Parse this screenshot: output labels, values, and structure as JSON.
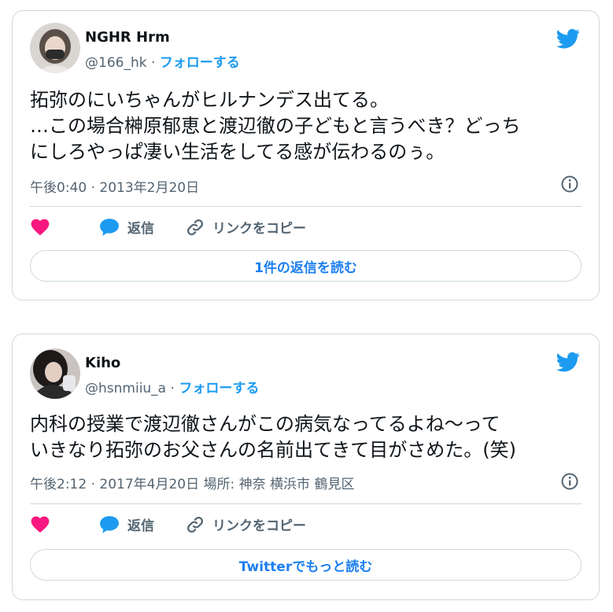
{
  "tweets": [
    {
      "display_name": "NGHR Hrm",
      "handle": "@166_hk",
      "separator": " · ",
      "follow_label": "フォローする",
      "text_lines": [
        "拓弥のにいちゃんがヒルナンデス出てる。",
        "…この場合榊原郁恵と渡辺徹の子どもと言うべき？どっち",
        "にしろやっぱ凄い生活をしてる感が伝わるのぅ。"
      ],
      "meta": "午後0:40 · 2013年2月20日",
      "reply_label": "返信",
      "copy_link_label": "リンクをコピー",
      "more_button_label": "1件の返信を読む"
    },
    {
      "display_name": "Kiho",
      "handle": "@hsnmiiu_a",
      "separator": " · ",
      "follow_label": "フォローする",
      "text_lines": [
        "内科の授業で渡辺徹さんがこの病気なってるよね〜って",
        "いきなり拓弥のお父さんの名前出てきて目がさめた。(笑)"
      ],
      "meta": "午後2:12 · 2017年4月20日 場所: 神奈 横浜市 鶴見区",
      "reply_label": "返信",
      "copy_link_label": "リンクをコピー",
      "more_button_label": "Twitterでもっと読む"
    }
  ],
  "colors": {
    "twitter_blue": "#1d9bf0",
    "like_pink": "#f91880",
    "secondary_text": "#536471",
    "border": "#cfd9de"
  },
  "icons": [
    "twitter-bird-icon",
    "info-icon",
    "heart-icon",
    "reply-bubble-icon",
    "link-icon"
  ]
}
